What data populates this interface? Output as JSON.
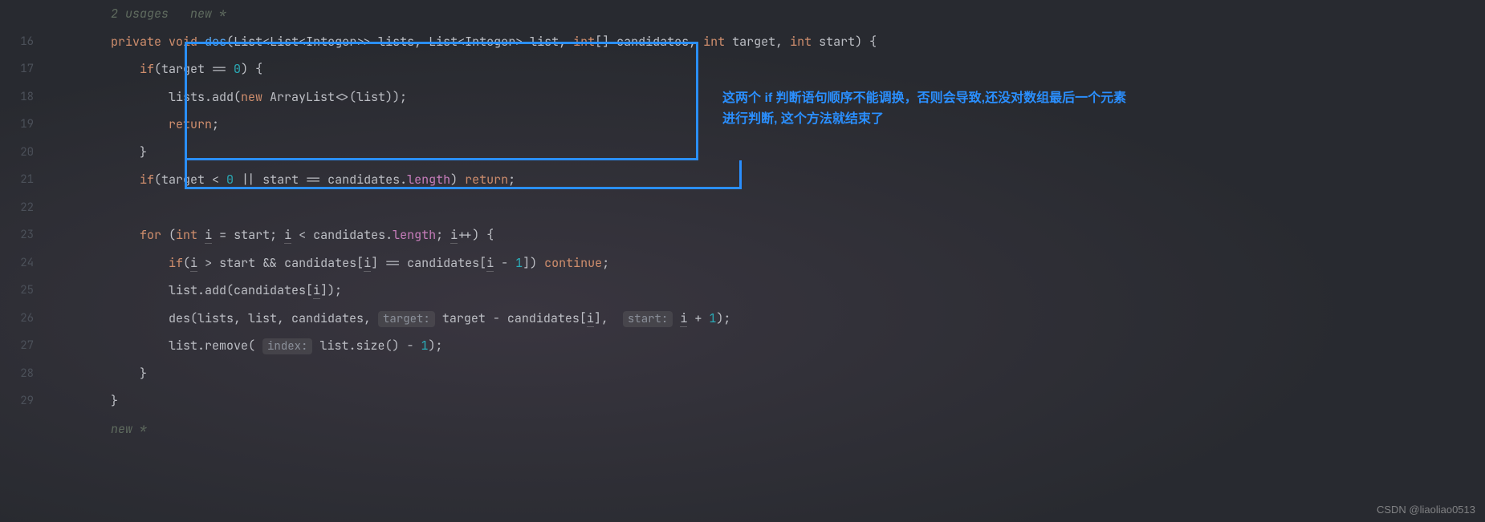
{
  "gutter": {
    "start": 15,
    "lines": [
      "",
      "16",
      "17",
      "18",
      "19",
      "20",
      "21",
      "22",
      "23",
      "24",
      "25",
      "26",
      "27",
      "28",
      "29",
      ""
    ]
  },
  "hints": {
    "usages": "2 usages   new *",
    "bottom": "new *"
  },
  "code": {
    "l16_private": "private",
    "l16_void": "void",
    "l16_des": "des",
    "l16_sig1": "(List<List<Integer>> lists, List<Integer> list, ",
    "l16_int1": "int",
    "l16_sig2": "[] candidates, ",
    "l16_int2": "int",
    "l16_sig3": " target, ",
    "l16_int3": "int",
    "l16_sig4": " start) {",
    "l17_if": "if",
    "l17_b": "(target == ",
    "l17_zero": "0",
    "l17_c": ") {",
    "l18_a": "lists.add(",
    "l18_new": "new",
    "l18_b": " ArrayList<>(list));",
    "l19_return": "return",
    "l19_semi": ";",
    "l20_brace": "}",
    "l21_if": "if",
    "l21_a": "(target < ",
    "l21_zero": "0",
    "l21_b": " || start == candidates.",
    "l21_len": "length",
    "l21_c": ") ",
    "l21_return": "return",
    "l21_semi": ";",
    "l23_for": "for",
    "l23_a": " (",
    "l23_int": "int",
    "l23_b": " ",
    "l23_i1": "i",
    "l23_c": " = start; ",
    "l23_i2": "i",
    "l23_d": " < candidates.",
    "l23_len": "length",
    "l23_e": "; ",
    "l23_i3": "i",
    "l23_f": "++) {",
    "l24_if": "if",
    "l24_a": "(",
    "l24_i1": "i",
    "l24_b": " > start && candidates[",
    "l24_i2": "i",
    "l24_c": "] == candidates[",
    "l24_i3": "i",
    "l24_d": " - ",
    "l24_one": "1",
    "l24_e": "]) ",
    "l24_cont": "continue",
    "l24_semi": ";",
    "l25_a": "list.add(candidates[",
    "l25_i": "i",
    "l25_b": "]);",
    "l26_a": "des(lists, list, candidates, ",
    "l26_hint1": "target:",
    "l26_b": " target - candidates[",
    "l26_i": "i",
    "l26_c": "],  ",
    "l26_hint2": "start:",
    "l26_d": " ",
    "l26_i2": "i",
    "l26_e": " + ",
    "l26_one": "1",
    "l26_f": ");",
    "l27_a": "list.remove( ",
    "l27_hint": "index:",
    "l27_b": " list.size() - ",
    "l27_one": "1",
    "l27_c": ");",
    "l28_brace": "}",
    "l29_brace": "}"
  },
  "annotation": {
    "line1": "这两个 if 判断语句顺序不能调换，否则会导致,还没对数组最后一个元素",
    "line2": "进行判断, 这个方法就结束了"
  },
  "watermark": "CSDN @liaoliao0513"
}
